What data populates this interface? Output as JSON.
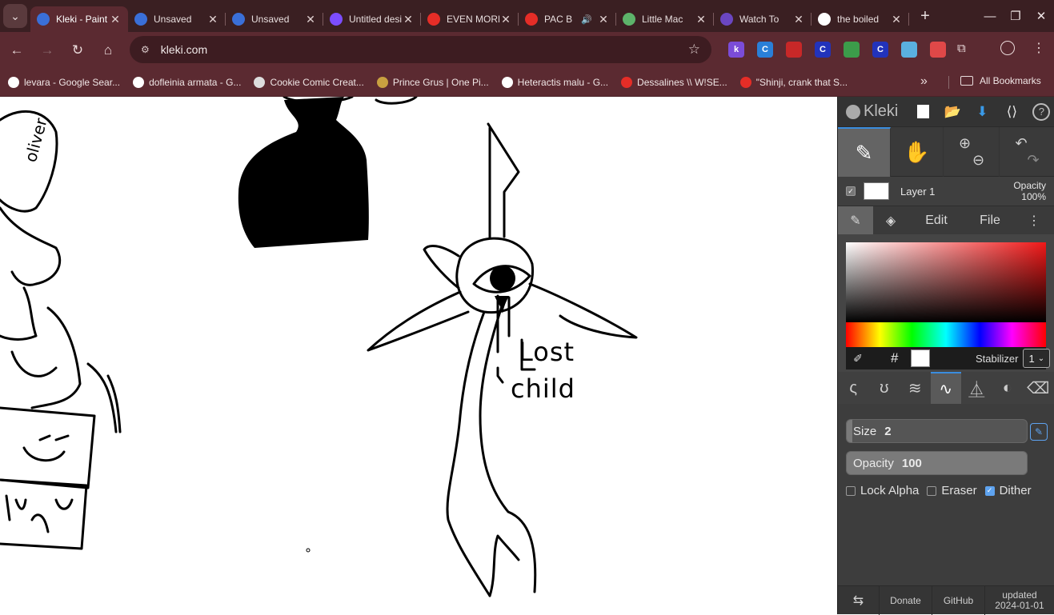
{
  "browser": {
    "tabs": [
      {
        "title": "Kleki - Paint Tool",
        "favicon": "kleki",
        "color": "#3a6fd8",
        "active": true
      },
      {
        "title": "Unsaved",
        "favicon": "kleki",
        "color": "#3a6fd8"
      },
      {
        "title": "Unsaved",
        "favicon": "kleki",
        "color": "#3a6fd8"
      },
      {
        "title": "Untitled design",
        "favicon": "canva",
        "color": "#7c4dff"
      },
      {
        "title": "EVEN MORE",
        "favicon": "youtube",
        "color": "#e52d27"
      },
      {
        "title": "PAC B",
        "favicon": "youtube",
        "color": "#e52d27",
        "audio": true
      },
      {
        "title": "Little Mac",
        "favicon": "wiki",
        "color": "#5db36a"
      },
      {
        "title": "Watch To",
        "favicon": "avatar",
        "color": "#6b46c1"
      },
      {
        "title": "the boiled",
        "favicon": "google",
        "color": "#ffffff"
      }
    ],
    "url": "kleki.com",
    "extensions": [
      {
        "label": "k",
        "color": "#7b4cd8"
      },
      {
        "label": "C",
        "color": "#2a7fd8"
      },
      {
        "label": "",
        "color": "#c82828"
      },
      {
        "label": "C",
        "color": "#2233bb"
      },
      {
        "label": "",
        "color": "#3c9c4a"
      },
      {
        "label": "C",
        "color": "#2233bb"
      },
      {
        "label": "",
        "color": "#5ab0e0"
      },
      {
        "label": "",
        "color": "#e04848"
      }
    ],
    "bookmarks": [
      {
        "label": "levara - Google Sear...",
        "favicon": "google"
      },
      {
        "label": "dofleinia armata - G...",
        "favicon": "google"
      },
      {
        "label": "Cookie Comic Creat...",
        "favicon": "cookie"
      },
      {
        "label": "Prince Grus | One Pi...",
        "favicon": "wiki"
      },
      {
        "label": "Heteractis malu - G...",
        "favicon": "google"
      },
      {
        "label": "Dessalines \\\\ W!SE...",
        "favicon": "youtube"
      },
      {
        "label": "\"Shinji, crank that S...",
        "favicon": "youtube"
      }
    ],
    "all_bookmarks": "All Bookmarks"
  },
  "canvas": {
    "text_lost": "Lost",
    "text_child": "child",
    "text_oliver": "oliver"
  },
  "kleki": {
    "logo": "Kleki",
    "layer": {
      "name": "Layer 1",
      "opacity_label": "Opacity",
      "opacity_value": "100%"
    },
    "tabs": {
      "edit": "Edit",
      "file": "File"
    },
    "color": {
      "hash": "#",
      "stabilizer_label": "Stabilizer",
      "stabilizer_value": "1"
    },
    "brush": {
      "size_label": "Size",
      "size_value": "2",
      "size_fraction": 0.02,
      "opacity_label": "Opacity",
      "opacity_value": "100",
      "opacity_fraction": 1.0
    },
    "options": {
      "lock_alpha": "Lock Alpha",
      "eraser": "Eraser",
      "dither": "Dither"
    },
    "footer": {
      "donate": "Donate",
      "github": "GitHub",
      "updated": "updated",
      "date": "2024-01-01"
    }
  }
}
